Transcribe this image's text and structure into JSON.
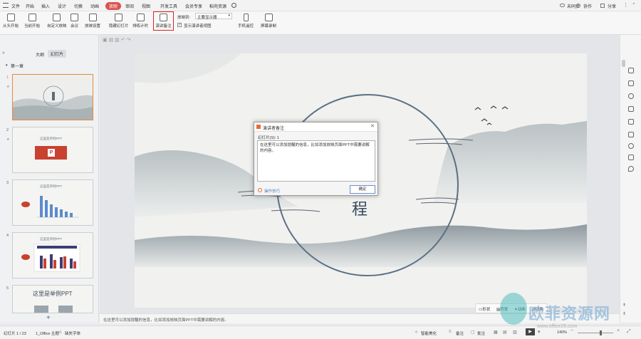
{
  "menubar": {
    "file": "文件",
    "home": "开始",
    "insert": "插入",
    "design": "设计",
    "transition": "切换",
    "animation": "动画",
    "show": "放映",
    "review": "审阅",
    "view": "视图",
    "devtools": "开发工具",
    "member": "会员专享",
    "resources": "稻壳资源",
    "unsynced": "未同步",
    "collab": "协作",
    "share": "分享"
  },
  "ribbon": {
    "from_start": "从头开始",
    "from_current": "当前开始",
    "custom_show": "自定义放映",
    "meeting": "会议",
    "show_settings": "放映设置",
    "hide_slide": "隐藏幻灯片",
    "rehearse": "排练计时",
    "presenter_notes": "演讲备注",
    "show_on_label": "放映到:",
    "show_on_value": "主要显示器",
    "show_presenter_view": "显示演讲者视图",
    "phone_remote": "手机遥控",
    "screen_record": "屏幕录制"
  },
  "panel": {
    "tab_outline": "大纲",
    "tab_slides": "幻灯片",
    "section": "第一章",
    "thumb2_title": "这里是单例PPT",
    "thumb3_title": "这里是单例PPT",
    "thumb4_title": "这里是单例PPT",
    "thumb5_title": "这里是举例PPT",
    "nums": [
      "1",
      "2",
      "3",
      "4",
      "5"
    ]
  },
  "slide": {
    "char": "程"
  },
  "dialog": {
    "title": "演讲者备注",
    "slide_label": "幻灯片(S): 1",
    "note_text": "在这里可以添加提醒的信息，比如添加放映页面PPT中需要讲解的内容。",
    "tips": "操作技巧",
    "ok": "确定"
  },
  "notes_text": "在这里可以添加提醒的信息，比如添加放映页面PPT中需要讲解的内容。",
  "bottombar": {
    "smart": "备注",
    "read": "智能美化",
    "notes": "批注",
    "zoom": "140%",
    "comment": "批注"
  },
  "status": {
    "slide_count": "幻灯片 1 / 23",
    "theme": "1_Office 主题",
    "missing_font": "缺失字体",
    "smart_beautify": "智能美化",
    "notes": "备注",
    "comment": "批注",
    "zoom": "140%"
  },
  "float_toolbar": {
    "shape": "形状",
    "bg": "背景",
    "anim": "动画",
    "toggle": "切换"
  },
  "watermark": {
    "cn": "欧菲资源网",
    "url": "www.office26.com"
  },
  "colors": {
    "accent": "#d9534f",
    "highlight": "#e02020",
    "thumb_sel": "#e8893b"
  }
}
